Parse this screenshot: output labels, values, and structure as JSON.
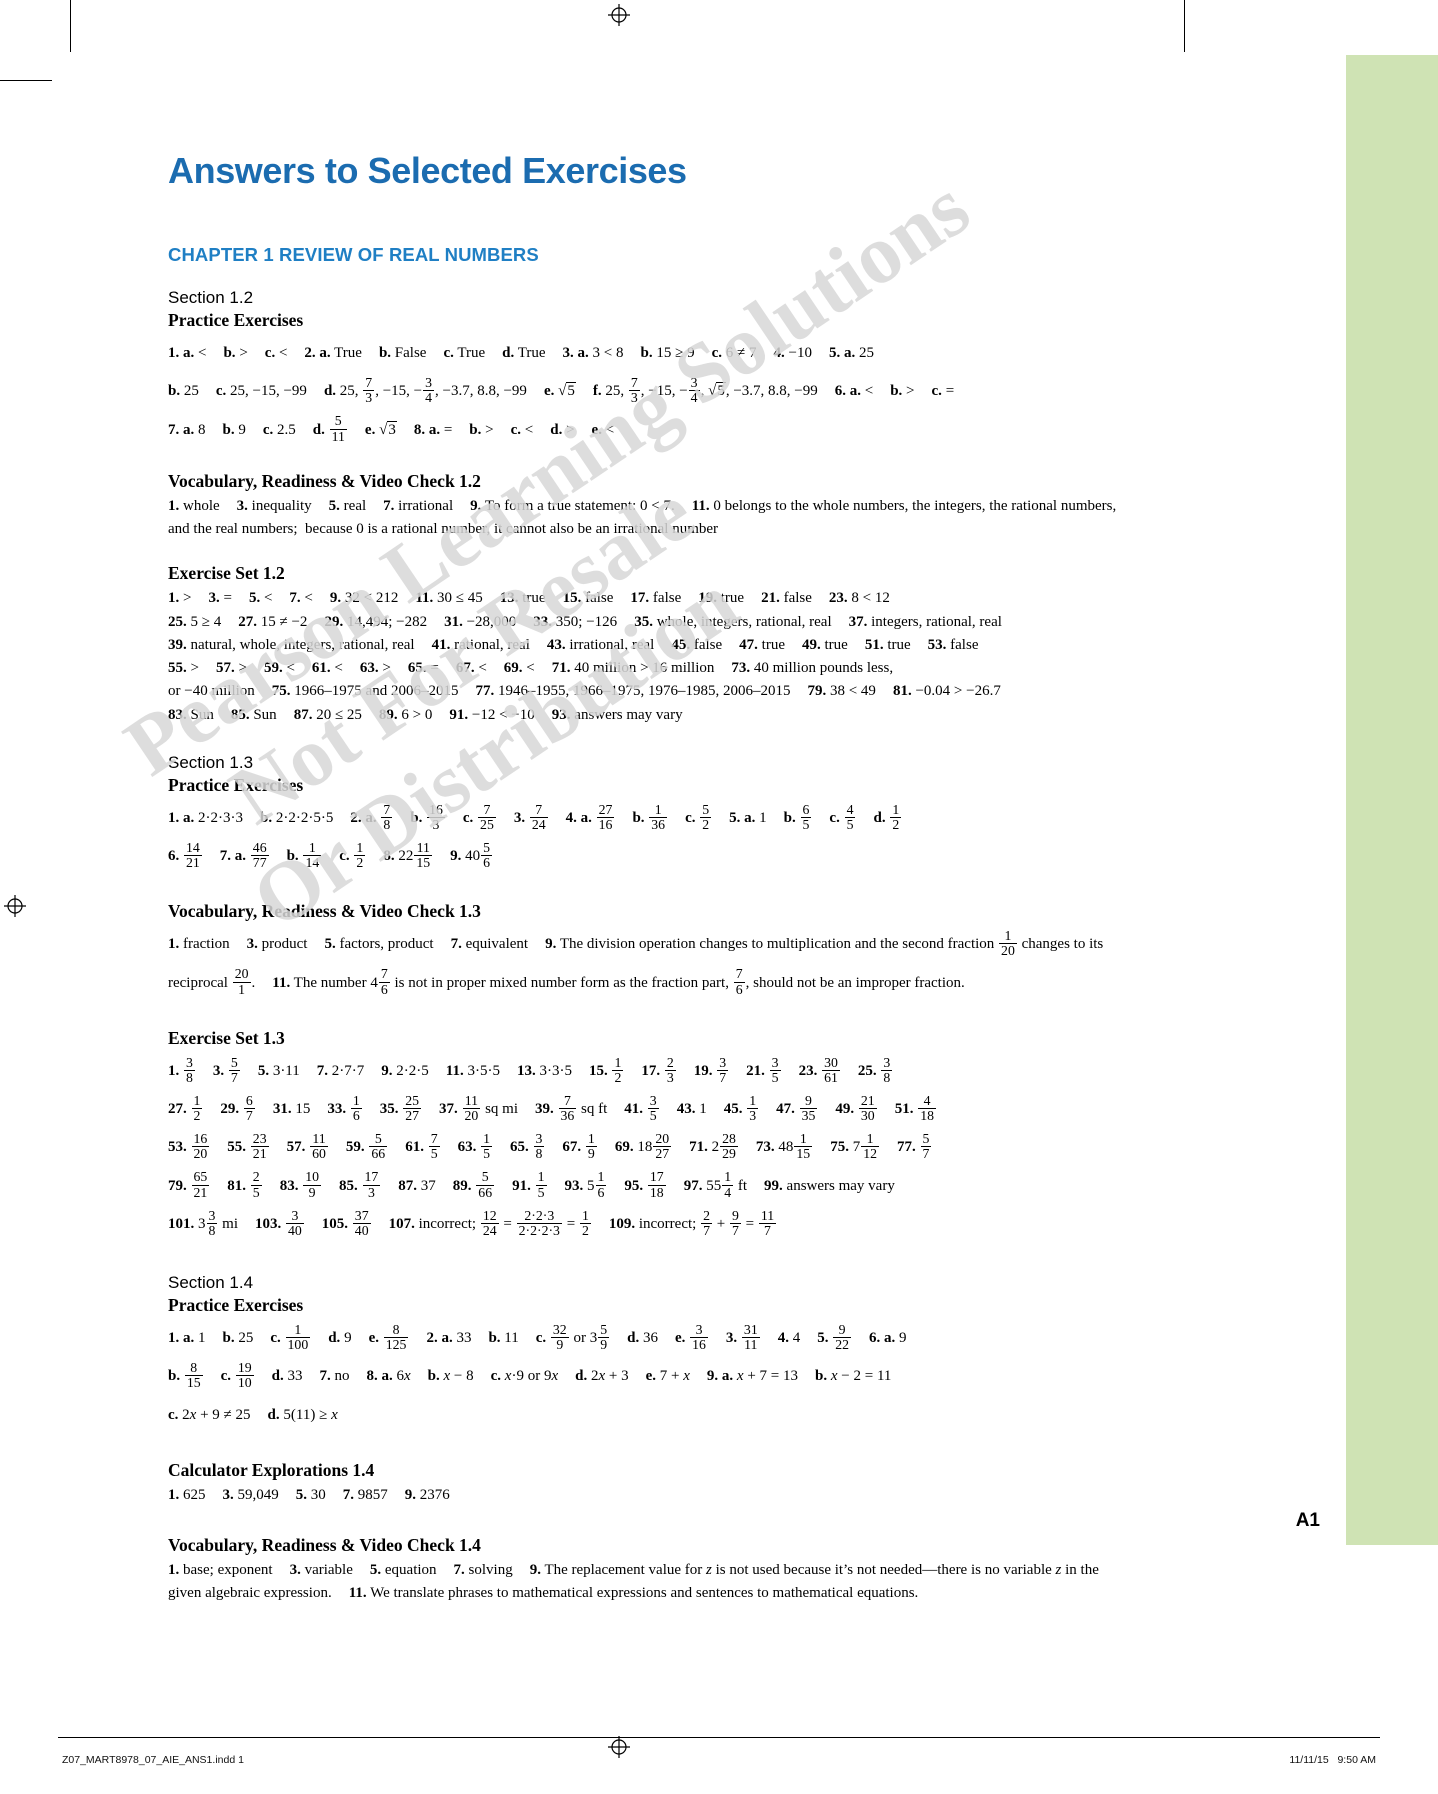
{
  "page": {
    "title": "Answers to Selected Exercises",
    "chapter_head": "CHAPTER 1  REVIEW OF REAL NUMBERS",
    "folio": "A1",
    "watermark_lines": [
      "Pearson Learning Solutions",
      "Not For Resale",
      "Or Distribution"
    ]
  },
  "footer": {
    "slug": "Z07_MART8978_07_AIE_ANS1.indd   1",
    "date": "11/11/15   9:50 AM"
  },
  "sections": [
    {
      "id": "section-1-2",
      "heading": "Section 1.2",
      "subheading": "Practice Exercises",
      "lines": [
        "1. a. <    b. >    c. <    2. a. True    b. False    c. True    d. True    3. a. 3 < 8    b. 15 ≥ 9    c. 6 ≠ 7    4. −10    5. a. 25",
        "b. 25    c. 25, −15, −99    d. 25, 7/3, −15, −3/4, −3.7, 8.8, −99    e. √5    f. 25, 7/3, −15, −3/4, √5, −3.7, 8.8, −99    6. a. <    b. >    c. =",
        "7. a. 8    b. 9    c. 2.5    d. 5/11    e. √3    8. a. =    b. >    c. <    d. >    e. <"
      ]
    },
    {
      "id": "vocab-1-2",
      "heading": "",
      "subheading": "Vocabulary, Readiness & Video Check 1.2",
      "lines": [
        "1. whole    3. inequality    5. real    7. irrational    9. To form a true statement: 0 < 7.    11. 0 belongs to the whole numbers, the integers, the rational numbers, and the real numbers;  because 0 is a rational number, it cannot also be an irrational number"
      ]
    },
    {
      "id": "exset-1-2",
      "heading": "",
      "subheading": "Exercise Set 1.2",
      "lines": [
        "1. >    3. =    5. <    7. <    9. 32 < 212    11. 30 ≤ 45    13. true    15. false    17. false    19. true    21. false    23. 8 < 12",
        "25. 5 ≥ 4    27. 15 ≠ −2    29. 14,494; −282    31. −28,000    33. 350; −126    35. whole, integers, rational, real    37. integers, rational, real",
        "39. natural, whole, integers, rational, real    41. rational, real    43. irrational, real    45. false    47. true    49. true    51. true    53. false",
        "55. >    57. >    59. <    61. <    63. >    65. =    67. <    69. <    71. 40 million > 16 million    73. 40 million pounds less,",
        "or −40 million    75. 1966–1975 and 2006–2015    77. 1946–1955, 1966–1975, 1976–1985, 2006–2015    79. 38 < 49    81. −0.04 > −26.7",
        "83. Sun    85. Sun    87. 20 ≤ 25    89. 6 > 0    91. −12 < −10    93. answers may vary"
      ]
    },
    {
      "id": "section-1-3",
      "heading": "Section 1.3",
      "subheading": "Practice Exercises",
      "lines": [
        "1. a. 2·2·3·3    b. 2·2·2·5·5    2. a. 7/8    b. 16/3    c. 7/25    3. 7/24    4. a. 27/16    b. 1/36    c. 5/2    5. a. 1    b. 6/5    c. 4/5    d. 1/2",
        "6. 14/21    7. a. 46/77    b. 1/14    c. 1/2    8. 22 11/15    9. 40 5/6"
      ]
    },
    {
      "id": "vocab-1-3",
      "heading": "",
      "subheading": "Vocabulary, Readiness & Video Check 1.3",
      "lines": [
        "1. fraction    3. product    5. factors, product    7. equivalent    9. The division operation changes to multiplication and the second fraction 1/20 changes to its reciprocal 20/1.    11. The number 4 7/6 is not in proper mixed number form as the fraction part, 7/6, should not be an improper fraction."
      ]
    },
    {
      "id": "exset-1-3",
      "heading": "",
      "subheading": "Exercise Set 1.3",
      "lines": [
        "1. 3/8    3. 5/7    5. 3·11    7. 2·7·7    9. 2·2·5    11. 3·5·5    13. 3·3·5    15. 1/2    17. 2/3    19. 3/7    21. 3/5    23. 30/61    25. 3/8",
        "27. 1/2    29. 6/7    31. 15    33. 1/6    35. 25/27    37. 11/20 sq mi    39. 7/36 sq ft    41. 3/5    43. 1    45. 1/3    47. 9/35    49. 21/30    51. 4/18",
        "53. 16/20    55. 23/21    57. 11/60    59. 5/66    61. 7/5    63. 1/5    65. 3/8    67. 1/9    69. 18 20/27    71. 2 28/29    73. 48 1/15    75. 7 1/12    77. 5/7",
        "79. 65/21    81. 2/5    83. 10/9    85. 17/3    87. 37    89. 5/66    91. 1/5    93. 5 1/6    95. 17/18    97. 55 1/4 ft    99. answers may vary",
        "101. 3 3/8 mi    103. 3/40    105. 37/40    107. incorrect; 12/24 = (2·2·3)/(2·2·2·3) = 1/2    109. incorrect; 2/7 + 9/7 = 11/7"
      ]
    },
    {
      "id": "section-1-4",
      "heading": "Section 1.4",
      "subheading": "Practice Exercises",
      "lines": [
        "1. a. 1    b. 25    c. 1/100    d. 9    e. 8/125    2. a. 33    b. 11    c. 32/9 or 3 5/9    d. 36    e. 3/16    3. 31/11    4. 4    5. 9/22    6. a. 9",
        "b. 8/15    c. 19/10    d. 33    7. no    8. a. 6x    b. x − 8    c. x·9 or 9x    d. 2x + 3    e. 7 + x    9. a. x + 7 = 13    b. x − 2 = 11",
        "c. 2x + 9 ≠ 25    d. 5(11) ≥ x"
      ]
    },
    {
      "id": "calc-1-4",
      "heading": "",
      "subheading": "Calculator Explorations 1.4",
      "lines": [
        "1. 625    3. 59,049    5. 30    7. 9857    9. 2376"
      ]
    },
    {
      "id": "vocab-1-4",
      "heading": "",
      "subheading": "Vocabulary, Readiness & Video Check 1.4",
      "lines": [
        "1. base; exponent    3. variable    5. equation    7. solving    9. The replacement value for z is not used because it’s not needed—there is no variable z in the given algebraic expression.    11. We translate phrases to mathematical expressions and sentences to mathematical equations."
      ]
    }
  ],
  "colors": {
    "title_blue": "#1b6cb0",
    "chapter_blue": "#1f7fc4",
    "edge_green": "#cfe3b4"
  }
}
